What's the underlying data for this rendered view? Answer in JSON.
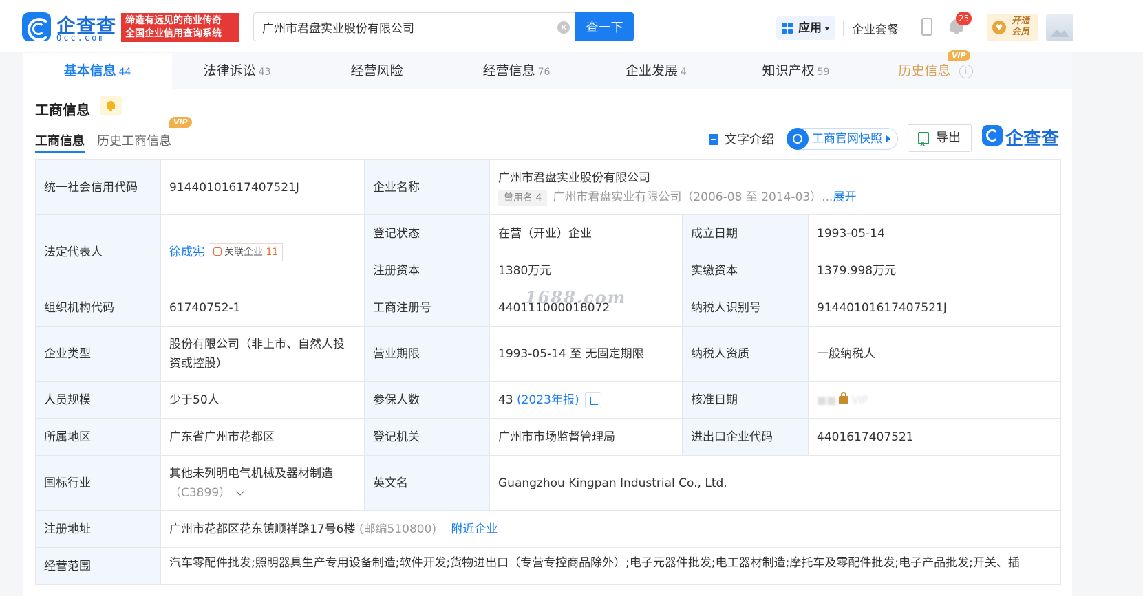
{
  "header": {
    "logo_text": "企查查",
    "logo_sub": "Qcc.com",
    "slogan_line1": "缔造有远见的商业传奇",
    "slogan_line2": "全国企业信用查询系统",
    "search_value": "广州市君盘实业股份有限公司",
    "search_button": "查一下",
    "apps_label": "应用",
    "package_label": "企业套餐",
    "notification_count": "25",
    "vip_line1": "开通",
    "vip_line2": "会员"
  },
  "tabs": [
    {
      "label": "基本信息",
      "count": "44"
    },
    {
      "label": "法律诉讼",
      "count": "43"
    },
    {
      "label": "经营风险",
      "count": ""
    },
    {
      "label": "经营信息",
      "count": "76"
    },
    {
      "label": "企业发展",
      "count": "4"
    },
    {
      "label": "知识产权",
      "count": "59"
    },
    {
      "label": "历史信息",
      "count": ""
    }
  ],
  "vip_tag": "VIP",
  "section": {
    "title": "工商信息",
    "subtab_active": "工商信息",
    "subtab_history": "历史工商信息",
    "text_intro": "文字介绍",
    "snapshot": "工商官网快照",
    "export": "导出",
    "brand": "企查查"
  },
  "table": {
    "credit_code_label": "统一社会信用代码",
    "credit_code": "91440101617407521J",
    "company_name_label": "企业名称",
    "company_name": "广州市君盘实业股份有限公司",
    "used_name_tag": "曾用名 4",
    "used_name": "广州市君盘实业有限公司（2006-08 至 2014-03）",
    "expand_ellipsis": "...",
    "expand": "展开",
    "legal_rep_label": "法定代表人",
    "legal_rep": "徐成宪",
    "related_label": "关联企业",
    "related_count": "11",
    "status_label": "登记状态",
    "status": "在营（开业）企业",
    "established_label": "成立日期",
    "established": "1993-05-14",
    "reg_capital_label": "注册资本",
    "reg_capital": "1380万元",
    "paid_capital_label": "实缴资本",
    "paid_capital": "1379.998万元",
    "org_code_label": "组织机构代码",
    "org_code": "61740752-1",
    "reg_no_label": "工商注册号",
    "reg_no": "440111000018072",
    "taxpayer_id_label": "纳税人识别号",
    "taxpayer_id": "91440101617407521J",
    "type_label": "企业类型",
    "type": "股份有限公司（非上市、自然人投资或控股）",
    "term_label": "营业期限",
    "term": "1993-05-14 至 无固定期限",
    "taxpayer_qual_label": "纳税人资质",
    "taxpayer_qual": "一般纳税人",
    "staff_label": "人员规模",
    "staff": "少于50人",
    "insured_label": "参保人数",
    "insured": "43",
    "insured_year": "(2023年报)",
    "approval_label": "核准日期",
    "approval_blur": "VIP",
    "region_label": "所属地区",
    "region": "广东省广州市花都区",
    "authority_label": "登记机关",
    "authority": "广州市市场监督管理局",
    "ie_code_label": "进出口企业代码",
    "ie_code": "4401617407521",
    "industry_label": "国标行业",
    "industry": "其他未列明电气机械及器材制造",
    "industry_code": "（C3899）",
    "english_label": "英文名",
    "english": "Guangzhou Kingpan Industrial Co., Ltd.",
    "address_label": "注册地址",
    "address": "广州市花都区花东镇顺祥路17号6楼",
    "postcode": "(邮编510800)",
    "nearby": "附近企业",
    "scope_label": "经营范围",
    "scope": "汽车零配件批发;照明器具生产专用设备制造;软件开发;货物进出口（专营专控商品除外）;电子元器件批发;电工器材制造;摩托车及零配件批发;电子产品批发;开关、插"
  },
  "watermark": "1688.com"
}
